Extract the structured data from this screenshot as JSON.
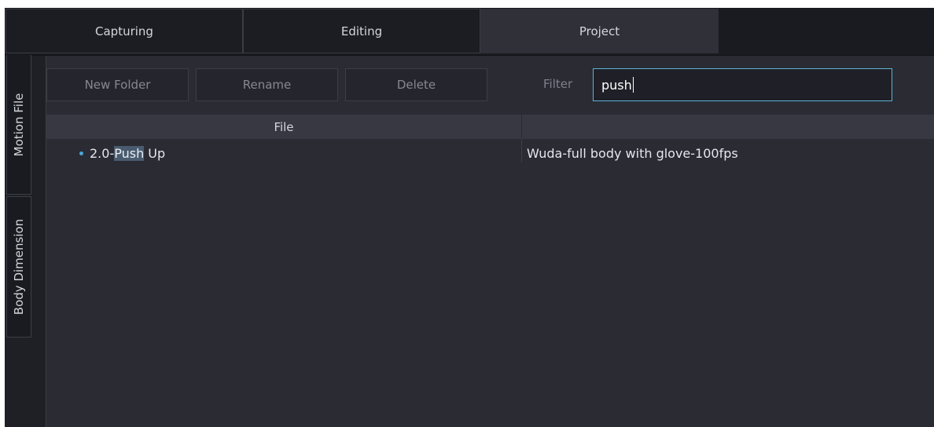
{
  "tabs": [
    {
      "label": "Capturing"
    },
    {
      "label": "Editing"
    },
    {
      "label": "Project"
    }
  ],
  "side_tabs": [
    {
      "label": "Motion File"
    },
    {
      "label": "Body Dimension"
    }
  ],
  "toolbar": {
    "new_folder_label": "New Folder",
    "rename_label": "Rename",
    "delete_label": "Delete",
    "filter_label": "Filter",
    "filter_value": "push"
  },
  "table": {
    "columns": [
      "File",
      ""
    ],
    "rows": [
      {
        "file_prefix": "2.0-",
        "file_match": "Push",
        "file_suffix": " Up",
        "description": "Wuda-full body with glove-100fps"
      }
    ]
  },
  "colors": {
    "accent": "#5cb4d8",
    "match_highlight": "#4a5b6f",
    "background": "#2a2b33"
  }
}
